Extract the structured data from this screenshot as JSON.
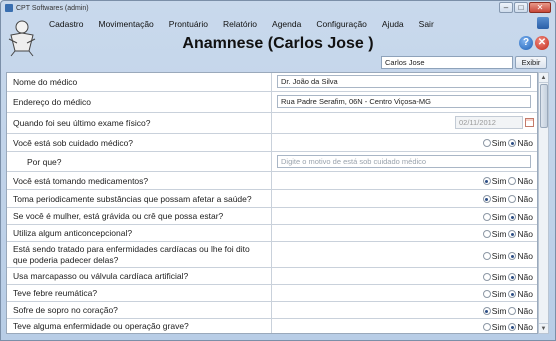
{
  "window": {
    "title": "CPT Softwares (admin)"
  },
  "menu": [
    "Cadastro",
    "Movimentação",
    "Prontuário",
    "Relatório",
    "Agenda",
    "Configuração",
    "Ajuda",
    "Sair"
  ],
  "header": {
    "title": "Anamnese (Carlos Jose )"
  },
  "search": {
    "value": "Carlos Jose",
    "button": "Exibir"
  },
  "options": {
    "yes": "Sim",
    "no": "Não"
  },
  "form": {
    "doctor_name_label": "Nome do médico",
    "doctor_name_value": "Dr. João da Silva",
    "doctor_address_label": "Endereço do médico",
    "doctor_address_value": "Rua Padre Serafim, 06N - Centro   Viçosa-MG",
    "last_exam_label": "Quando foi seu último exame físico?",
    "last_exam_value": "02/11/2012",
    "why_label": "Por que?",
    "why_placeholder": "Digite o motivo de está sob cuidado médico"
  },
  "questions": [
    {
      "text": "Você está sob cuidado médico?",
      "answer": "Não"
    },
    {
      "text": "Você está tomando medicamentos?",
      "answer": "Sim"
    },
    {
      "text": "Toma periodicamente substâncias que possam afetar a saúde?",
      "answer": "Sim"
    },
    {
      "text": "Se você é mulher, está grávida ou crê que possa estar?",
      "answer": "Não"
    },
    {
      "text": "Utiliza algum anticoncepcional?",
      "answer": "Não"
    },
    {
      "text": "Está sendo tratado para enfermidades cardíacas ou lhe foi dito que poderia padecer delas?",
      "answer": "Não"
    },
    {
      "text": "Usa marcapasso ou válvula cardíaca artificial?",
      "answer": "Não"
    },
    {
      "text": "Teve febre reumática?",
      "answer": "Não"
    },
    {
      "text": "Sofre de sopro no coração?",
      "answer": "Sim"
    },
    {
      "text": "Teve alguma enfermidade ou operação grave?",
      "answer": "Não"
    }
  ]
}
